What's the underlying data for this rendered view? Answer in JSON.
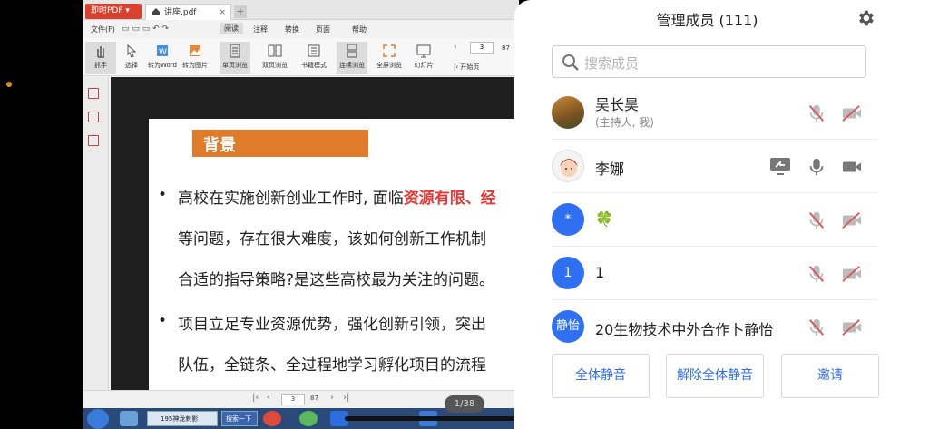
{
  "pdf_app": {
    "app_tab": "即时PDF",
    "doc_tab": "讲座.pdf",
    "menu": [
      "文件(F)",
      "阅读",
      "注释",
      "转换",
      "页面",
      "帮助"
    ],
    "tools": [
      "抓手",
      "选择",
      "转为Word",
      "转为图片",
      "单页浏览",
      "双页浏览",
      "书籍模式",
      "连续浏览",
      "全屏浏览",
      "幻灯片"
    ],
    "page_current": "3",
    "page_total": "87",
    "start_page": "开始页",
    "bottom_page": "3",
    "bottom_total": "87"
  },
  "slide": {
    "heading": "背景",
    "bullet1_line1_a": "高校在实施创新创业工作时, 面临",
    "bullet1_line1_red": "资源有限、经",
    "bullet1_line2": "等问题，存在很大难度，该如何创新工作机制",
    "bullet1_line3": "合适的指导策略?是这些高校最为关注的问题。",
    "bullet2_line1": "项目立足专业资源优势，强化创新引领，突出",
    "bullet2_line2": "队伍，全链条、全过程地学习孵化项目的流程"
  },
  "page_counter": "1/38",
  "taskbar": {
    "item1": "195神龙刺影",
    "item2": "搜索一下"
  },
  "panel": {
    "title": "管理成员 (111)",
    "search_placeholder": "搜索成员",
    "members": [
      {
        "name": "吴长昊",
        "sub": "(主持人, 我)",
        "avatar_text": ""
      },
      {
        "name": "李娜",
        "sub": "",
        "avatar_text": ""
      },
      {
        "name": "🍀",
        "sub": "",
        "avatar_text": "*"
      },
      {
        "name": "1",
        "sub": "",
        "avatar_text": "1"
      },
      {
        "name": "20生物技术中外合作卜静怡",
        "sub": "",
        "avatar_text": "静怡"
      }
    ],
    "buttons": {
      "mute_all": "全体静音",
      "unmute_all": "解除全体静音",
      "invite": "邀请"
    }
  },
  "colors": {
    "accent": "#2f6ff2",
    "muted_red": "#e05252",
    "slide_orange": "#e07b2c",
    "slide_red": "#e53935"
  }
}
